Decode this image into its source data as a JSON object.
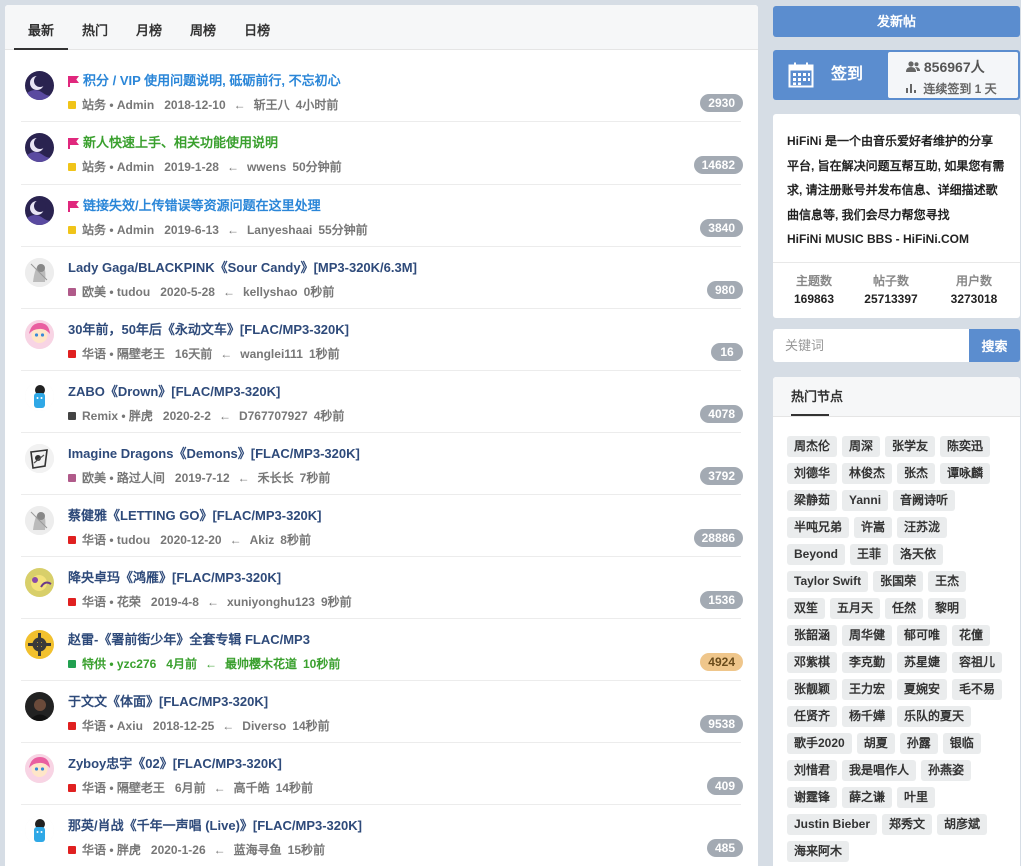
{
  "tabs": [
    "最新",
    "热门",
    "月榜",
    "周榜",
    "日榜"
  ],
  "threads": [
    {
      "title": "积分 / VIP 使用问题说明, 砥砺前行, 不忘初心",
      "style": "blue",
      "flag": true,
      "category": "站务",
      "cat_color": "#f0c419",
      "author": "Admin",
      "date": "2018-12-10",
      "last_user": "斩王八",
      "last_time": "4小时前",
      "count": "2930",
      "avatar": "moon"
    },
    {
      "title": "新人快速上手、相关功能使用说明",
      "style": "green",
      "flag": true,
      "category": "站务",
      "cat_color": "#f0c419",
      "author": "Admin",
      "date": "2019-1-28",
      "last_user": "wwens",
      "last_time": "50分钟前",
      "count": "14682",
      "avatar": "moon"
    },
    {
      "title": "链接失效/上传错误等资源问题在这里处理",
      "style": "blue",
      "flag": true,
      "category": "站务",
      "cat_color": "#f0c419",
      "author": "Admin",
      "date": "2019-6-13",
      "last_user": "Lanyeshaai",
      "last_time": "55分钟前",
      "count": "3840",
      "avatar": "moon"
    },
    {
      "title": "Lady Gaga/BLACKPINK《Sour Candy》[MP3-320K/6.3M]",
      "style": "",
      "flag": false,
      "category": "欧美",
      "cat_color": "#b05a8a",
      "author": "tudou",
      "date": "2020-5-28",
      "last_user": "kellyshao",
      "last_time": "0秒前",
      "count": "980",
      "avatar": "sketch"
    },
    {
      "title": "30年前，50年后《永动文车》[FLAC/MP3-320K]",
      "style": "",
      "flag": false,
      "category": "华语",
      "cat_color": "#e02020",
      "author": "隔壁老王",
      "date": "16天前",
      "last_user": "wanglei111",
      "last_time": "1秒前",
      "count": "16",
      "avatar": "girl"
    },
    {
      "title": "ZABO《Drown》[FLAC/MP3-320K]",
      "style": "",
      "flag": false,
      "category": "Remix",
      "cat_color": "#444444",
      "author": "胖虎",
      "date": "2020-2-2",
      "last_user": "D767707927",
      "last_time": "4秒前",
      "count": "4078",
      "avatar": "blue"
    },
    {
      "title": "Imagine Dragons《Demons》[FLAC/MP3-320K]",
      "style": "",
      "flag": false,
      "category": "欧美",
      "cat_color": "#b05a8a",
      "author": "路过人间",
      "date": "2019-7-12",
      "last_user": "禾长长",
      "last_time": "7秒前",
      "count": "3792",
      "avatar": "sketch2"
    },
    {
      "title": "蔡健雅《LETTING GO》[FLAC/MP3-320K]",
      "style": "",
      "flag": false,
      "category": "华语",
      "cat_color": "#e02020",
      "author": "tudou",
      "date": "2020-12-20",
      "last_user": "Akiz",
      "last_time": "8秒前",
      "count": "28886",
      "avatar": "sketch"
    },
    {
      "title": "降央卓玛《鸿雁》[FLAC/MP3-320K]",
      "style": "",
      "flag": false,
      "category": "华语",
      "cat_color": "#e02020",
      "author": "花荣",
      "date": "2019-4-8",
      "last_user": "xuniyonghu123",
      "last_time": "9秒前",
      "count": "1536",
      "avatar": "yellow"
    },
    {
      "title": "赵雷-《署前街少年》全套专辑 FLAC/MP3",
      "style": "",
      "flag": false,
      "category": "特供",
      "cat_color": "#22a050",
      "author": "yzc276",
      "date": "4月前",
      "last_user": "最帅樱木花道",
      "last_time": "10秒前",
      "count": "4924",
      "hot": true,
      "meta_green": true,
      "avatar": "gear"
    },
    {
      "title": "于文文《体面》[FLAC/MP3-320K]",
      "style": "",
      "flag": false,
      "category": "华语",
      "cat_color": "#e02020",
      "author": "Axiu",
      "date": "2018-12-25",
      "last_user": "Diverso",
      "last_time": "14秒前",
      "count": "9538",
      "avatar": "dark"
    },
    {
      "title": "Zyboy忠宇《02》[FLAC/MP3-320K]",
      "style": "",
      "flag": false,
      "category": "华语",
      "cat_color": "#e02020",
      "author": "隔壁老王",
      "date": "6月前",
      "last_user": "高千皓",
      "last_time": "14秒前",
      "count": "409",
      "avatar": "girl"
    },
    {
      "title": "那英/肖战《千年一声唱 (Live)》[FLAC/MP3-320K]",
      "style": "",
      "flag": false,
      "category": "华语",
      "cat_color": "#e02020",
      "author": "胖虎",
      "date": "2020-1-26",
      "last_user": "蓝海寻鱼",
      "last_time": "15秒前",
      "count": "485",
      "avatar": "blue"
    }
  ],
  "sidebar": {
    "post_button": "发新帖",
    "signin_label": "签到",
    "signin_users": "856967人",
    "signin_streak": "连续签到 1 天",
    "intro_lines": [
      "HiFiNi 是一个由音乐爱好者维护的分享",
      "平台, 旨在解决问题互帮互助, 如果您有需",
      "求, 请注册账号并发布信息、详细描述歌",
      "曲信息等, 我们会尽力帮您寻找",
      "HiFiNi MUSIC BBS - HiFiNi.COM"
    ],
    "stats": [
      {
        "label": "主题数",
        "value": "169863"
      },
      {
        "label": "帖子数",
        "value": "25713397"
      },
      {
        "label": "用户数",
        "value": "3273018"
      }
    ],
    "search_placeholder": "关键词",
    "search_button": "搜索",
    "hot_title": "热门节点",
    "tags": [
      "周杰伦",
      "周深",
      "张学友",
      "陈奕迅",
      "刘德华",
      "林俊杰",
      "张杰",
      "谭咏麟",
      "梁静茹",
      "Yanni",
      "音阙诗听",
      "半吨兄弟",
      "许嵩",
      "汪苏泷",
      "Beyond",
      "王菲",
      "洛天依",
      "Taylor Swift",
      "张国荣",
      "王杰",
      "双笙",
      "五月天",
      "任然",
      "黎明",
      "张韶涵",
      "周华健",
      "郁可唯",
      "花僮",
      "邓紫棋",
      "李克勤",
      "苏星婕",
      "容祖儿",
      "张靓颖",
      "王力宏",
      "夏婉安",
      "毛不易",
      "任贤齐",
      "杨千嬅",
      "乐队的夏天",
      "歌手2020",
      "胡夏",
      "孙露",
      "银临",
      "刘惜君",
      "我是唱作人",
      "孙燕姿",
      "谢霆锋",
      "薛之谦",
      "叶里",
      "Justin Bieber",
      "郑秀文",
      "胡彦斌",
      "海来阿木"
    ]
  }
}
